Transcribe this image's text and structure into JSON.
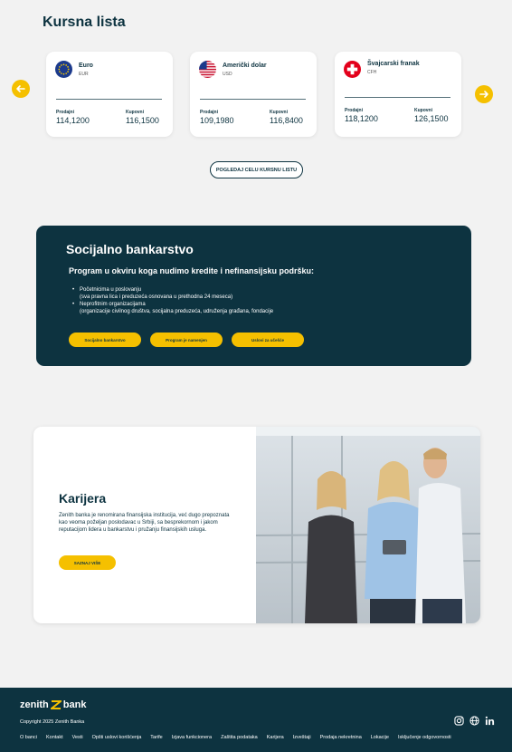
{
  "exchange": {
    "title": "Kursna lista",
    "view_all_label": "POGLEDAJ CELU KURSNU LISTU",
    "sell_label": "Prodajni",
    "buy_label": "Kupovni",
    "cards": [
      {
        "name": "Euro",
        "code": "EUR",
        "sell": "114,1200",
        "buy": "116,1500",
        "flag_icon": "eu-flag-icon"
      },
      {
        "name": "Američki dolar",
        "code": "USD",
        "sell": "109,1980",
        "buy": "116,8400",
        "flag_icon": "us-flag-icon"
      },
      {
        "name": "Švajcarski franak",
        "code": "CFH",
        "sell": "118,1200",
        "buy": "126,1500",
        "flag_icon": "ch-flag-icon"
      }
    ]
  },
  "social": {
    "title": "Socijalno bankarstvo",
    "subtitle": "Program u okviru koga nudimo kredite i nefinansijsku podršku:",
    "items": [
      {
        "line1": "Početnicima u poslovanju",
        "line2": "(sva pravna lica i preduzeća osnovana u prethodna 24 meseca)"
      },
      {
        "line1": "Neprofitnim organizacijama",
        "line2": "(organizacije civilnog društva, socijalna preduzeća, udruženja građana, fondacije"
      }
    ],
    "buttons": [
      "Socijalno bankarstvo",
      "Program je namenjen",
      "Uslovi za učešće"
    ]
  },
  "career": {
    "title": "Karijera",
    "text": "Zenith banka je renomirana finansijska institucija, već dugo prepoznata kao veoma poželjan poslodavac u Srbiji, sa besprekornom i jakom reputacijom lidera u bankarstvu i pružanju finansijskih usluga.",
    "button": "SAZNAJ VIŠE"
  },
  "footer": {
    "logo_left": "zenith",
    "logo_right": "bank",
    "copyright": "Copyright 2025 Zenith Banka",
    "links": [
      "O banci",
      "Kontakt",
      "Vesti",
      "Opšti uslovi korišćenja",
      "Tarife",
      "Izjava funkcionera",
      "Zaštita podataka",
      "Karijera",
      "Izveštaji",
      "Prodaja nekretnina",
      "Lokacije",
      "Isključenje odgovornosti"
    ],
    "social_icons": [
      "instagram-icon",
      "globe-icon",
      "linkedin-icon"
    ]
  },
  "colors": {
    "primary": "#0d3340",
    "accent": "#f5c000",
    "background": "#f2f2f2"
  }
}
